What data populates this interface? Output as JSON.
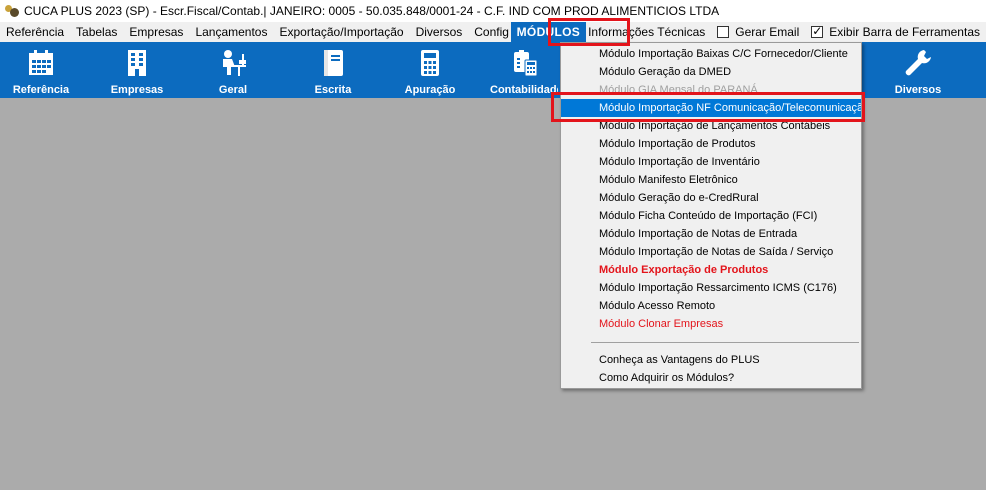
{
  "window": {
    "title": "CUCA PLUS 2023 (SP) - Escr.Fiscal/Contab.| JANEIRO: 0005 - 50.035.848/0001-24 - C.F. IND COM PROD ALIMENTICIOS LTDA"
  },
  "menubar": {
    "items": [
      "Referência",
      "Tabelas",
      "Empresas",
      "Lançamentos",
      "Exportação/Importação",
      "Diversos",
      "Configurações",
      "MÓDULOS",
      "Informações Técnicas"
    ],
    "active": "MÓDULOS",
    "gerar_email": {
      "label": "Gerar Email",
      "checked": false
    },
    "exibir_barra": {
      "label": "Exibir Barra de Ferramentas",
      "checked": true
    }
  },
  "toolbar": {
    "buttons": [
      {
        "label": "Referência",
        "icon": "calendar-icon"
      },
      {
        "label": "Empresas",
        "icon": "building-icon"
      },
      {
        "label": "Geral",
        "icon": "person-at-desk-icon"
      },
      {
        "label": "Escrita",
        "icon": "book-icon"
      },
      {
        "label": "Apuração",
        "icon": "calculator-icon"
      },
      {
        "label": "Contabilidade",
        "icon": "accounting-icon"
      },
      {
        "label": "Diversos",
        "icon": "wrench-icon"
      }
    ],
    "color": "#0c6bbf"
  },
  "modulos_menu": {
    "items": [
      {
        "label": "Módulo Importação Baixas C/C Fornecedor/Cliente",
        "style": "normal"
      },
      {
        "label": "Módulo Geração da DMED",
        "style": "normal"
      },
      {
        "label": "Módulo GIA Mensal do PARANÁ",
        "style": "disabled"
      },
      {
        "label": "Módulo Importação NF Comunicação/Telecomunicação",
        "style": "highlighted"
      },
      {
        "label": "Módulo Importação de Lançamentos Contábeis",
        "style": "normal"
      },
      {
        "label": "Módulo Importação de Produtos",
        "style": "normal"
      },
      {
        "label": "Módulo Importação de Inventário",
        "style": "normal"
      },
      {
        "label": "Módulo Manifesto Eletrônico",
        "style": "normal"
      },
      {
        "label": "Módulo Geração do e-CredRural",
        "style": "normal"
      },
      {
        "label": "Módulo Ficha Conteúdo de Importação (FCI)",
        "style": "normal"
      },
      {
        "label": "Módulo Importação de Notas de Entrada",
        "style": "normal"
      },
      {
        "label": "Módulo Importação de Notas de Saída / Serviço",
        "style": "normal"
      },
      {
        "label": "Módulo Exportação de Produtos",
        "style": "red-bold"
      },
      {
        "label": "Módulo Importação Ressarcimento ICMS (C176)",
        "style": "normal"
      },
      {
        "label": "Módulo Acesso Remoto",
        "style": "normal"
      },
      {
        "label": "Módulo Clonar Empresas",
        "style": "red"
      }
    ],
    "footer_items": [
      {
        "label": "Conheça as Vantagens do PLUS"
      },
      {
        "label": "Como Adquirir os Módulos?"
      }
    ]
  },
  "colors": {
    "highlight": "#0078d7",
    "annotation_red": "#e3141b",
    "background": "#ababab"
  }
}
